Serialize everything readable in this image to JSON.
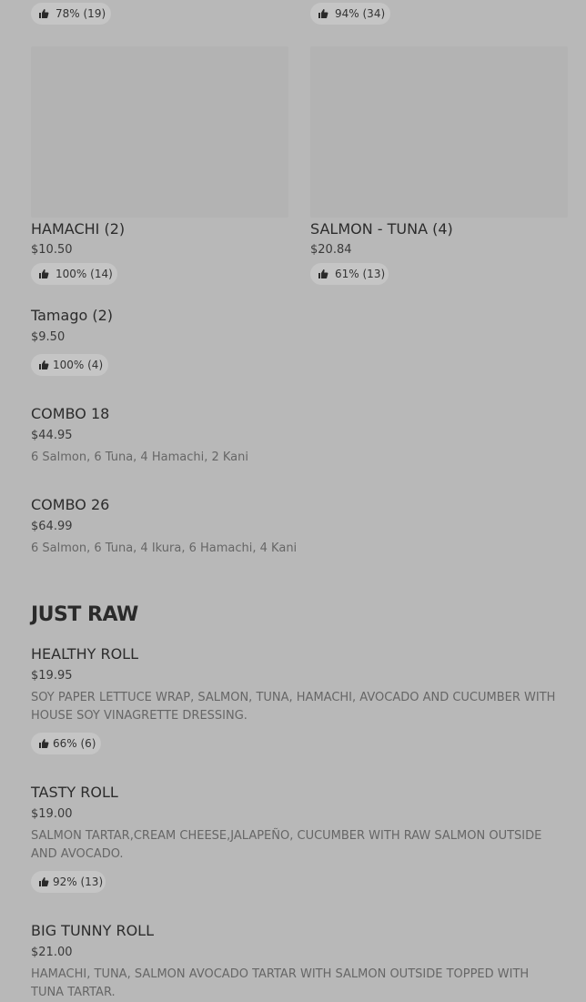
{
  "top_ratings": [
    {
      "percent": "78%",
      "count": "(19)"
    },
    {
      "percent": "94%",
      "count": "(34)"
    }
  ],
  "grid_items": [
    {
      "name": "HAMACHI (2)",
      "price": "$10.50",
      "percent": "100%",
      "count": "(14)"
    },
    {
      "name": "SALMON - TUNA (4)",
      "price": "$20.84",
      "percent": "61%",
      "count": "(13)"
    }
  ],
  "list_items": [
    {
      "name": "Tamago (2)",
      "price": "$9.50",
      "rating": "100% (4)"
    },
    {
      "name": "COMBO 18",
      "price": "$44.95",
      "description": "6 Salmon, 6 Tuna, 4 Hamachi, 2 Kani"
    },
    {
      "name": "COMBO 26",
      "price": "$64.99",
      "description": "6 Salmon, 6 Tuna, 4 Ikura, 6 Hamachi, 4 Kani"
    }
  ],
  "section": {
    "title": "JUST RAW"
  },
  "raw_items": [
    {
      "name": "HEALTHY ROLL",
      "price": "$19.95",
      "description": "SOY PAPER LETTUCE WRAP, SALMON, TUNA, HAMACHI, AVOCADO AND CUCUMBER WITH HOUSE SOY VINAGRETTE DRESSING.",
      "rating": "66% (6)"
    },
    {
      "name": "TASTY ROLL",
      "price": "$19.00",
      "description": "SALMON TARTAR,CREAM CHEESE,JALAPEÑO, CUCUMBER WITH RAW SALMON OUTSIDE AND AVOCADO.",
      "rating": "92% (13)"
    },
    {
      "name": "BIG TUNNY ROLL",
      "price": "$21.00",
      "description": "HAMACHI, TUNA, SALMON AVOCADO TARTAR WITH SALMON OUTSIDE TOPPED WITH TUNA TARTAR."
    }
  ],
  "icons": {
    "rating": "thumbs-up-icon"
  }
}
